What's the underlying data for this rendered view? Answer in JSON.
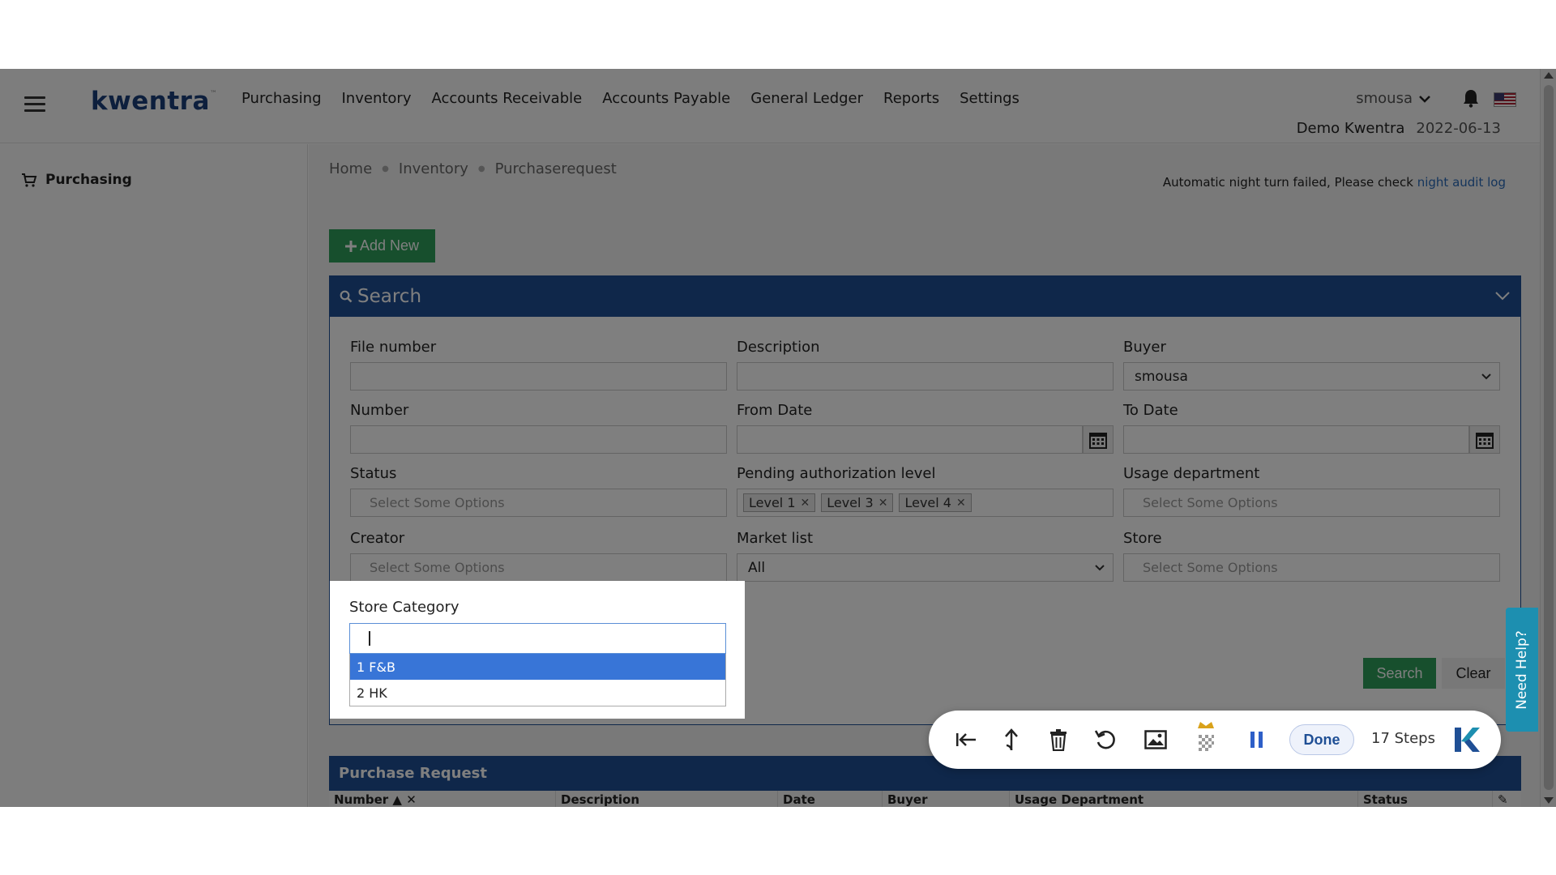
{
  "app": {
    "logo_text": "kwentra",
    "logo_mark": "™",
    "nav": [
      "Purchasing",
      "Inventory",
      "Accounts Receivable",
      "Accounts Payable",
      "General Ledger",
      "Reports",
      "Settings"
    ],
    "username": "smousa",
    "company": "Demo Kwentra",
    "date": "2022-06-13"
  },
  "sidebar": {
    "item": "Purchasing"
  },
  "breadcrumb": [
    "Home",
    "Inventory",
    "Purchaserequest"
  ],
  "alert": {
    "text": "Automatic night turn failed, Please check",
    "link": "night audit log"
  },
  "add_new_label": "Add New",
  "search_panel": {
    "title": "Search",
    "fields": {
      "file_number": {
        "label": "File number",
        "value": ""
      },
      "description": {
        "label": "Description",
        "value": ""
      },
      "buyer": {
        "label": "Buyer",
        "value": "smousa"
      },
      "number": {
        "label": "Number",
        "value": ""
      },
      "from_date": {
        "label": "From Date",
        "value": ""
      },
      "to_date": {
        "label": "To Date",
        "value": ""
      },
      "status": {
        "label": "Status",
        "placeholder": "Select Some Options"
      },
      "pending_auth": {
        "label": "Pending authorization level",
        "chips": [
          "Level 1",
          "Level 3",
          "Level 4"
        ]
      },
      "usage_department": {
        "label": "Usage department",
        "placeholder": "Select Some Options"
      },
      "creator": {
        "label": "Creator",
        "placeholder": "Select Some Options"
      },
      "market_list": {
        "label": "Market list",
        "value": "All"
      },
      "store": {
        "label": "Store",
        "placeholder": "Select Some Options"
      },
      "store_category": {
        "label": "Store Category",
        "options": [
          "1 F&B",
          "2 HK"
        ],
        "highlighted_index": 0
      }
    },
    "search_label": "Search",
    "clear_label": "Clear"
  },
  "purchase_request": {
    "title": "Purchase Request",
    "columns": [
      "Number",
      "Description",
      "Date",
      "Buyer",
      "Usage Department",
      "Status"
    ]
  },
  "need_help_label": "Need Help?",
  "recorder": {
    "done_label": "Done",
    "steps_label": "17 Steps"
  }
}
